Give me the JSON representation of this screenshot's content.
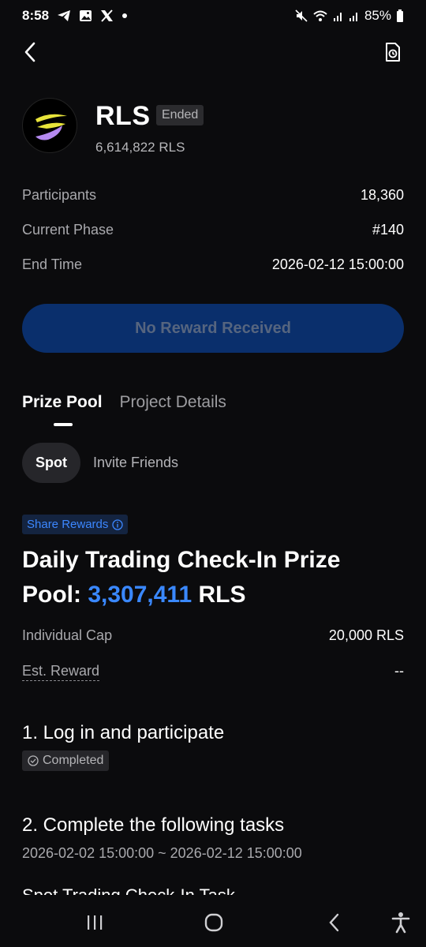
{
  "status_bar": {
    "time": "8:58",
    "battery": "85%",
    "icons_left": [
      "telegram-icon",
      "gallery-icon",
      "x-icon",
      "dot-icon"
    ],
    "icons_right": [
      "mute-icon",
      "wifi-icon",
      "signal-icon",
      "signal-icon",
      "battery-icon"
    ]
  },
  "nav": {
    "back_icon": "chevron-left-icon",
    "history_icon": "document-clock-icon"
  },
  "token": {
    "name": "RLS",
    "status": "Ended",
    "amount": "6,614,822 RLS"
  },
  "info": [
    {
      "label": "Participants",
      "value": "18,360"
    },
    {
      "label": "Current Phase",
      "value": "#140"
    },
    {
      "label": "End Time",
      "value": "2026-02-12 15:00:00"
    }
  ],
  "reward_button": "No Reward Received",
  "tabs": [
    {
      "label": "Prize Pool",
      "active": true
    },
    {
      "label": "Project Details",
      "active": false
    }
  ],
  "subtabs": [
    {
      "label": "Spot",
      "active": true
    },
    {
      "label": "Invite Friends",
      "active": false
    }
  ],
  "share_badge": "Share Rewards",
  "pool": {
    "title_line1": "Daily Trading Check-In Prize",
    "title_prefix": "Pool: ",
    "amount": "3,307,411",
    "unit": " RLS"
  },
  "cap": {
    "individual_cap_label": "Individual Cap",
    "individual_cap_value": "20,000 RLS",
    "est_reward_label": "Est. Reward",
    "est_reward_value": "--"
  },
  "tasks": {
    "step1": "1. Log in and participate",
    "step1_status": "Completed",
    "step2": "2. Complete the following tasks",
    "step2_range": "2026-02-02 15:00:00 ~ 2026-02-12 15:00:00",
    "step3_cut": "Spot Trading Check-In Task"
  },
  "colors": {
    "background": "#0b0b0d",
    "accent_blue": "#3a88ff",
    "button_bg": "#0a2f6c",
    "muted_text": "#a9a9ad"
  }
}
